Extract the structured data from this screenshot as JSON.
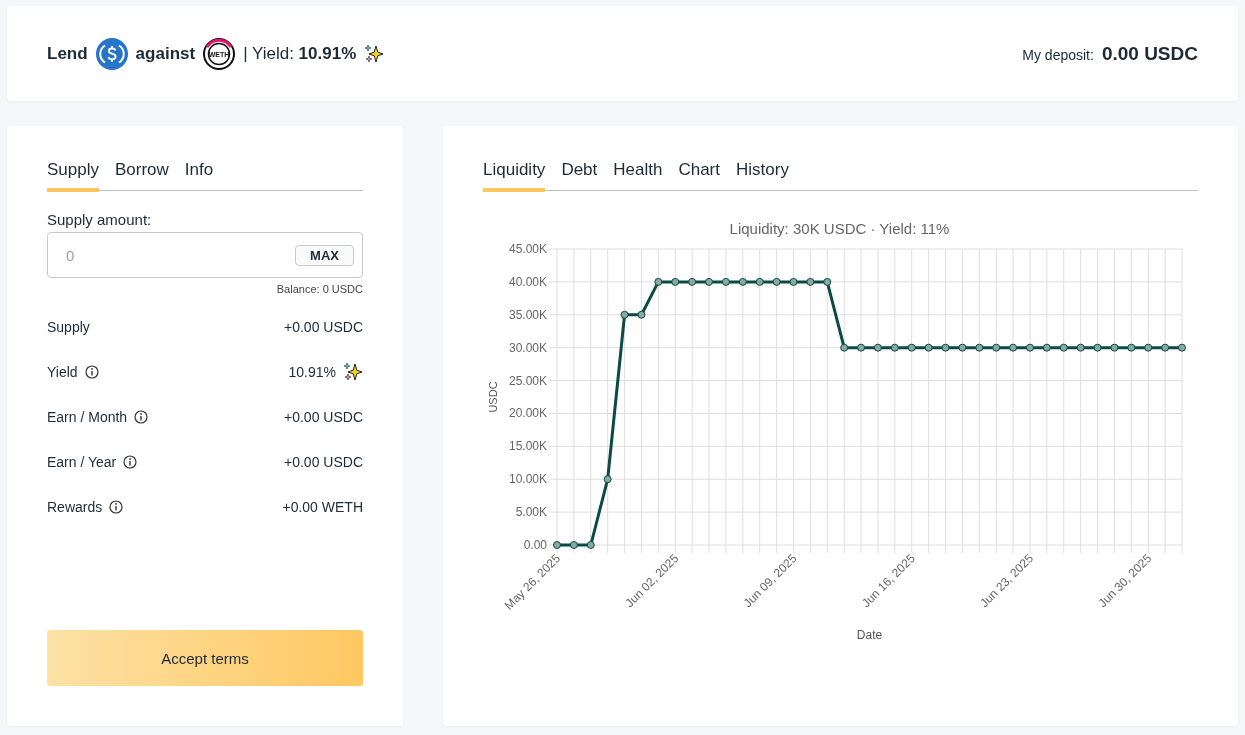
{
  "header": {
    "lend_label": "Lend",
    "against_label": "against",
    "collateral_token_label": "WETH",
    "yield_label": "| Yield:",
    "yield_value": "10.91%",
    "deposit_label": "My deposit:",
    "deposit_value": "0.00 USDC"
  },
  "supply_panel": {
    "tabs": [
      {
        "label": "Supply",
        "selected": true
      },
      {
        "label": "Borrow",
        "selected": false
      },
      {
        "label": "Info",
        "selected": false
      }
    ],
    "amount_label": "Supply amount:",
    "amount_field": {
      "placeholder": "0"
    },
    "max_button": "MAX",
    "balance": "Balance: 0 USDC",
    "rows": [
      {
        "label": "Supply",
        "value": "+0.00 USDC",
        "info": false,
        "sparkle": false
      },
      {
        "label": "Yield",
        "value": "10.91%",
        "info": true,
        "sparkle": true
      },
      {
        "label": "Earn / Month",
        "value": "+0.00 USDC",
        "info": true,
        "sparkle": false
      },
      {
        "label": "Earn / Year",
        "value": "+0.00 USDC",
        "info": true,
        "sparkle": false
      },
      {
        "label": "Rewards",
        "value": "+0.00 WETH",
        "info": true,
        "sparkle": false
      }
    ],
    "accept_button": "Accept terms"
  },
  "chart_panel": {
    "tabs": [
      {
        "label": "Liquidity",
        "selected": true
      },
      {
        "label": "Debt",
        "selected": false
      },
      {
        "label": "Health",
        "selected": false
      },
      {
        "label": "Chart",
        "selected": false
      },
      {
        "label": "History",
        "selected": false
      }
    ],
    "chart_data": {
      "type": "line",
      "title": "Liquidity: 30K USDC · Yield: 11%",
      "xlabel": "Date",
      "ylabel": "USDC",
      "categories": [
        "May 26, 2025",
        null,
        null,
        null,
        null,
        null,
        null,
        "Jun 02, 2025",
        null,
        null,
        null,
        null,
        null,
        null,
        "Jun 09, 2025",
        null,
        null,
        null,
        null,
        null,
        null,
        "Jun 16, 2025",
        null,
        null,
        null,
        null,
        null,
        null,
        "Jun 23, 2025",
        null,
        null,
        null,
        null,
        null,
        null,
        "Jun 30, 2025",
        null,
        null
      ],
      "grid": true,
      "series": [
        {
          "color": "#0b4a45",
          "marker": "circle",
          "values": [
            0,
            0,
            0,
            10000,
            35000,
            35000,
            40000,
            40000,
            40000,
            40000,
            40000,
            40000,
            40000,
            40000,
            40000,
            40000,
            40000,
            30000,
            30000,
            30000,
            30000,
            30000,
            30000,
            30000,
            30000,
            30000,
            30000,
            30000,
            30000,
            30000,
            30000,
            30000,
            30000,
            30000,
            30000,
            30000,
            30000,
            30000
          ]
        }
      ],
      "ylim": [
        0,
        45000
      ],
      "yticks": [
        {
          "value": 0,
          "label": "0.00"
        },
        {
          "value": 5000,
          "label": "5.00K"
        },
        {
          "value": 10000,
          "label": "10.00K"
        },
        {
          "value": 15000,
          "label": "15.00K"
        },
        {
          "value": 20000,
          "label": "20.00K"
        },
        {
          "value": 25000,
          "label": "25.00K"
        },
        {
          "value": 30000,
          "label": "30.00K"
        },
        {
          "value": 35000,
          "label": "35.00K"
        },
        {
          "value": 40000,
          "label": "40.00K"
        },
        {
          "value": 45000,
          "label": "45.00K"
        }
      ]
    }
  }
}
